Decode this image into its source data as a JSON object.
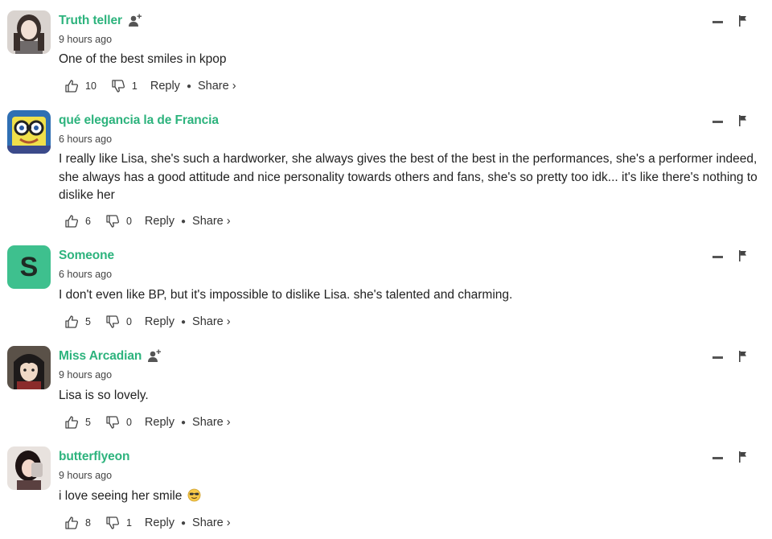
{
  "comments": [
    {
      "username": "Truth teller",
      "time": "9 hours ago",
      "text": "One of the best smiles in kpop",
      "likes": "10",
      "dislikes": "1",
      "reply_label": "Reply",
      "share_label": "Share ›",
      "avatar_type": "photo",
      "has_follow": true
    },
    {
      "username": "qué elegancia la de Francia",
      "time": "6 hours ago",
      "text": "I really like Lisa, she's such a hardworker, she always gives the best of the best in the performances, she's a performer indeed, she always has a good attitude and nice personality towards others and fans, she's so pretty too idk... it's like there's nothing to dislike her",
      "likes": "6",
      "dislikes": "0",
      "reply_label": "Reply",
      "share_label": "Share ›",
      "avatar_type": "cartoon",
      "has_follow": false
    },
    {
      "username": "Someone",
      "time": "6 hours ago",
      "text": "I don't even like BP, but it's impossible to dislike Lisa. she's talented and charming.",
      "likes": "5",
      "dislikes": "0",
      "reply_label": "Reply",
      "share_label": "Share ›",
      "avatar_type": "letter",
      "avatar_letter": "S",
      "has_follow": false
    },
    {
      "username": "Miss Arcadian",
      "time": "9 hours ago",
      "text": "Lisa is so lovely.",
      "likes": "5",
      "dislikes": "0",
      "reply_label": "Reply",
      "share_label": "Share ›",
      "avatar_type": "anime",
      "has_follow": true
    },
    {
      "username": "butterflyeon",
      "time": "9 hours ago",
      "text": "i love seeing her smile",
      "likes": "8",
      "dislikes": "1",
      "reply_label": "Reply",
      "share_label": "Share ›",
      "avatar_type": "photo2",
      "has_follow": false,
      "emoji": "smiling-face-with-sunglasses"
    }
  ],
  "colors": {
    "username": "#2db37d",
    "avatar_letter_bg": "#3ec08e",
    "text": "#222222"
  }
}
